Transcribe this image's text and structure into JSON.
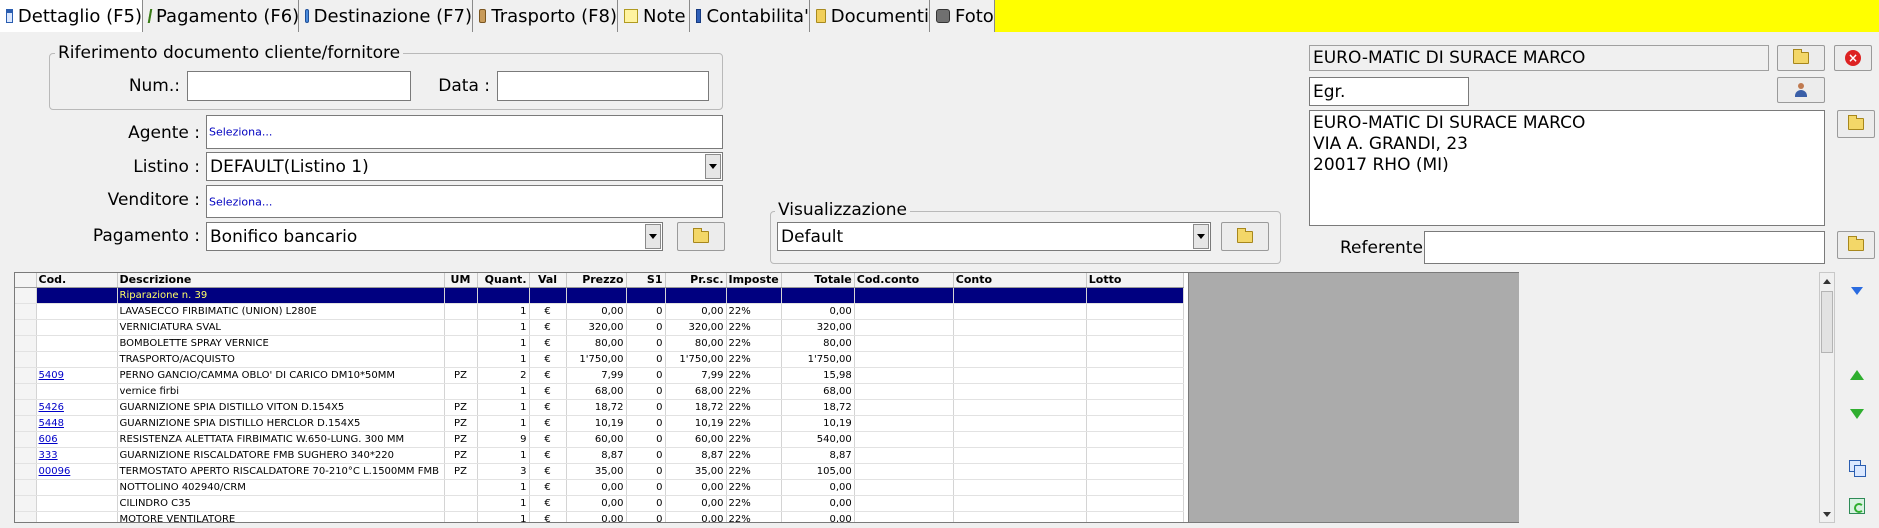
{
  "tabs": [
    {
      "label": "Dettaglio (F5)",
      "icon": "window-icon"
    },
    {
      "label": "Pagamento (F6)",
      "icon": "payment-icon"
    },
    {
      "label": "Destinazione (F7)",
      "icon": "destination-icon"
    },
    {
      "label": "Trasporto (F8)",
      "icon": "truck-icon"
    },
    {
      "label": "Note",
      "icon": "note-icon"
    },
    {
      "label": "Contabilita'",
      "icon": "ledger-icon"
    },
    {
      "label": "Documenti",
      "icon": "folder-icon"
    },
    {
      "label": "Foto",
      "icon": "camera-icon"
    }
  ],
  "ref_group": {
    "title": "Riferimento documento cliente/fornitore",
    "num_label": "Num.:",
    "num_value": "",
    "data_label": "Data :",
    "data_value": ""
  },
  "form": {
    "agente_label": "Agente :",
    "agente_value": "Seleziona...",
    "listino_label": "Listino :",
    "listino_value": "DEFAULT(Listino 1)",
    "venditore_label": "Venditore :",
    "venditore_value": "Seleziona...",
    "pagamento_label": "Pagamento :",
    "pagamento_value": "Bonifico bancario"
  },
  "visualizzazione": {
    "title": "Visualizzazione",
    "value": "Default"
  },
  "customer": {
    "name": "EURO-MATIC DI SURACE MARCO",
    "title": "Egr.",
    "address_lines": [
      "EURO-MATIC DI SURACE MARCO",
      "VIA A. GRANDI, 23",
      "20017 RHO (MI)"
    ],
    "referente_label": "Referente",
    "referente_value": ""
  },
  "grid": {
    "columns": [
      "Cod.",
      "Descrizione",
      "UM",
      "Quant.",
      "Val",
      "Prezzo",
      "S1",
      "Pr.sc.",
      "Imposte",
      "Totale",
      "Cod.conto",
      "Conto",
      "Lotto"
    ],
    "rows": [
      {
        "cod": "",
        "desc": "Riparazione n. 39",
        "um": "",
        "quant": "",
        "val": "",
        "prezzo": "",
        "s1": "",
        "prsc": "",
        "imposte": "",
        "totale": "",
        "selected": true
      },
      {
        "cod": "",
        "desc": "LAVASECCO FIRBIMATIC (UNION) L280E",
        "um": "",
        "quant": "1",
        "val": "€",
        "prezzo": "0,00",
        "s1": "0",
        "prsc": "0,00",
        "imposte": "22%",
        "totale": "0,00"
      },
      {
        "cod": "",
        "desc": "VERNICIATURA SVAL",
        "um": "",
        "quant": "1",
        "val": "€",
        "prezzo": "320,00",
        "s1": "0",
        "prsc": "320,00",
        "imposte": "22%",
        "totale": "320,00"
      },
      {
        "cod": "",
        "desc": "BOMBOLETTE SPRAY VERNICE",
        "um": "",
        "quant": "1",
        "val": "€",
        "prezzo": "80,00",
        "s1": "0",
        "prsc": "80,00",
        "imposte": "22%",
        "totale": "80,00"
      },
      {
        "cod": "",
        "desc": "TRASPORTO/ACQUISTO",
        "um": "",
        "quant": "1",
        "val": "€",
        "prezzo": "1'750,00",
        "s1": "0",
        "prsc": "1'750,00",
        "imposte": "22%",
        "totale": "1'750,00"
      },
      {
        "cod": "5409",
        "desc": "PERNO GANCIO/CAMMA OBLO' DI CARICO DM10*50MM",
        "um": "PZ",
        "quant": "2",
        "val": "€",
        "prezzo": "7,99",
        "s1": "0",
        "prsc": "7,99",
        "imposte": "22%",
        "totale": "15,98"
      },
      {
        "cod": "",
        "desc": "vernice firbi",
        "um": "",
        "quant": "1",
        "val": "€",
        "prezzo": "68,00",
        "s1": "0",
        "prsc": "68,00",
        "imposte": "22%",
        "totale": "68,00"
      },
      {
        "cod": "5426",
        "desc": "GUARNIZIONE SPIA DISTILLO VITON D.154X5",
        "um": "PZ",
        "quant": "1",
        "val": "€",
        "prezzo": "18,72",
        "s1": "0",
        "prsc": "18,72",
        "imposte": "22%",
        "totale": "18,72"
      },
      {
        "cod": "5448",
        "desc": "GUARNIZIONE SPIA DISTILLO HERCLOR D.154X5",
        "um": "PZ",
        "quant": "1",
        "val": "€",
        "prezzo": "10,19",
        "s1": "0",
        "prsc": "10,19",
        "imposte": "22%",
        "totale": "10,19"
      },
      {
        "cod": "606",
        "desc": "RESISTENZA ALETTATA FIRBIMATIC W.650-LUNG. 300 MM",
        "um": "PZ",
        "quant": "9",
        "val": "€",
        "prezzo": "60,00",
        "s1": "0",
        "prsc": "60,00",
        "imposte": "22%",
        "totale": "540,00"
      },
      {
        "cod": "333",
        "desc": "GUARNIZIONE RISCALDATORE FMB SUGHERO 340*220",
        "um": "PZ",
        "quant": "1",
        "val": "€",
        "prezzo": "8,87",
        "s1": "0",
        "prsc": "8,87",
        "imposte": "22%",
        "totale": "8,87"
      },
      {
        "cod": "00096",
        "desc": "TERMOSTATO APERTO RISCALDATORE 70-210°C L.1500MM FMB",
        "um": "PZ",
        "quant": "3",
        "val": "€",
        "prezzo": "35,00",
        "s1": "0",
        "prsc": "35,00",
        "imposte": "22%",
        "totale": "105,00"
      },
      {
        "cod": "",
        "desc": "NOTTOLINO 402940/CRM",
        "um": "",
        "quant": "1",
        "val": "€",
        "prezzo": "0,00",
        "s1": "0",
        "prsc": "0,00",
        "imposte": "22%",
        "totale": "0,00"
      },
      {
        "cod": "",
        "desc": "CILINDRO C35",
        "um": "",
        "quant": "1",
        "val": "€",
        "prezzo": "0,00",
        "s1": "0",
        "prsc": "0,00",
        "imposte": "22%",
        "totale": "0,00"
      },
      {
        "cod": "",
        "desc": "MOTORE VENTILATORE",
        "um": "",
        "quant": "1",
        "val": "€",
        "prezzo": "0,00",
        "s1": "0",
        "prsc": "0,00",
        "imposte": "22%",
        "totale": "0,00"
      }
    ]
  },
  "colors": {
    "tabbar_bg": "#ffff00",
    "selected_row_bg": "#000080",
    "selected_row_text": "#ffff66",
    "link": "#0000c8"
  }
}
